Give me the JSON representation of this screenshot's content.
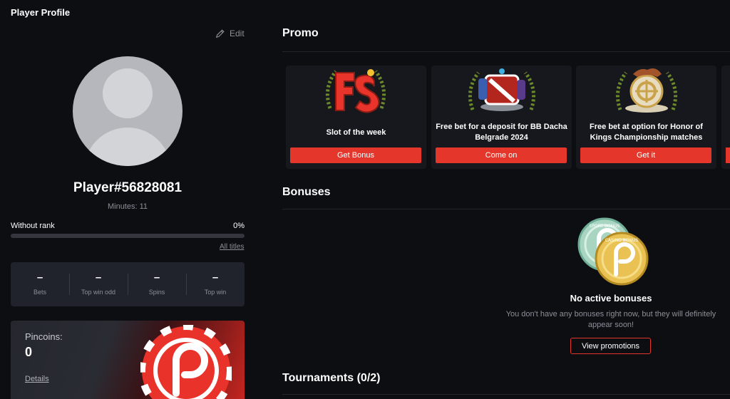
{
  "app": {
    "title": "Player Profile"
  },
  "profile": {
    "edit_label": "Edit",
    "player_name": "Player#56828081",
    "minutes": "Minutes: 11",
    "rank_label": "Without rank",
    "rank_percent": "0%",
    "rank_progress": 0,
    "all_titles": "All titles",
    "stats": [
      {
        "value": "–",
        "label": "Bets"
      },
      {
        "value": "–",
        "label": "Top win odd"
      },
      {
        "value": "–",
        "label": "Spins"
      },
      {
        "value": "–",
        "label": "Top win"
      }
    ],
    "pincoins": {
      "label": "Pincoins:",
      "value": "0",
      "details": "Details"
    }
  },
  "promo": {
    "title": "Promo",
    "cards": [
      {
        "title": "Slot of the week",
        "button": "Get Bonus",
        "icon": "fs-badge-icon"
      },
      {
        "title": "Free bet for a deposit for BB Dacha Belgrade 2024",
        "button": "Come on",
        "icon": "dota-hero-icon"
      },
      {
        "title": "Free bet at option for Honor of Kings Championship matches",
        "button": "Get it",
        "icon": "honor-of-kings-icon"
      }
    ]
  },
  "bonuses": {
    "title": "Bonuses",
    "empty_title": "No active bonuses",
    "empty_text": "You don't have any bonuses right now, but they will definitely appear soon!",
    "view_button": "View promotions",
    "coin_labels": [
      "SPORT BONUS",
      "CASINO BONUS"
    ]
  },
  "tournaments": {
    "title": "Tournaments (0/2)"
  },
  "colors": {
    "accent": "#e4362b",
    "background": "#0d0e12",
    "card": "#16181d"
  }
}
